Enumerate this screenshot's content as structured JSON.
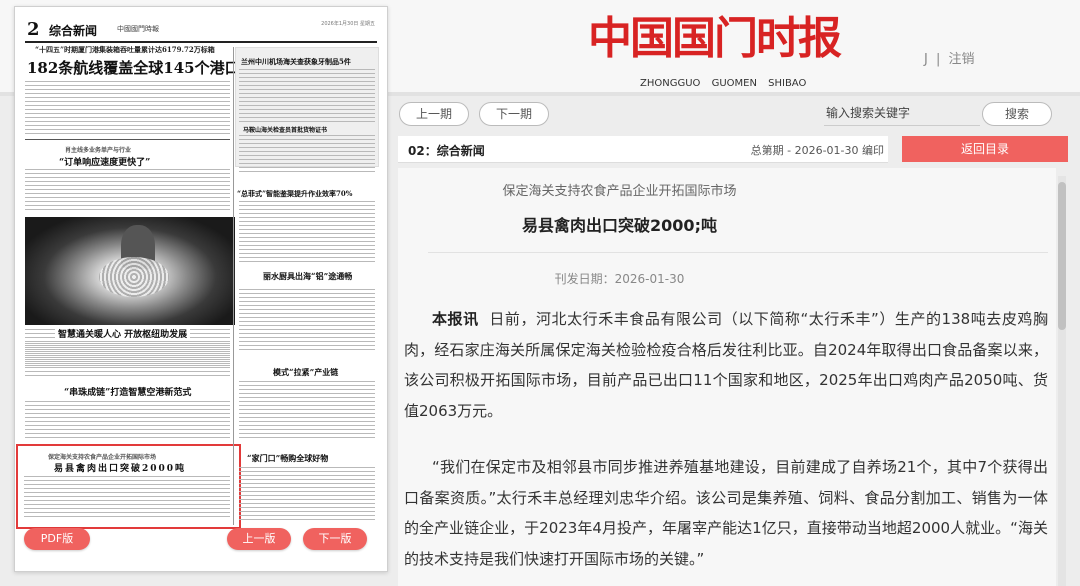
{
  "paper": {
    "page_number": "2",
    "section": "综合新闻",
    "masthead_small": "中國國門時報",
    "date_small": "2026年1月30日 星期五",
    "kicker_top": "“十四五”时期厦门港集装箱吞吐量累计达6179.72万标箱",
    "headline_main": "182条航线覆盖全球145个港口",
    "kicker_2": "肖主线多业务单产与行业",
    "headline_2": "“订单响应速度更快了”",
    "headline_3": "智慧通关暖人心  开放枢纽助发展",
    "headline_4": "“串珠成链”打造智慧空港新范式",
    "kicker_5": "保定海关支持农食产品企业开拓国际市场",
    "headline_5": "易县禽肉出口突破2000吨",
    "side_1": "兰州中川机场海关查获象牙制品5件",
    "side_2": "马鞍山海关检查员首批货物证书",
    "side_3": "“总菲式”智能鉴渠提升作业效率70%",
    "side_4": "丽水厨具出海“铝”途通畅",
    "side_5": "模式“拉紧”产业链",
    "side_6": "“家门口”畅购全球好物",
    "pdf_label": "PDF版",
    "prev_label": "上一版",
    "next_label": "下一版"
  },
  "header": {
    "logo_cn": "中国国门时报",
    "logo_en": "ZHONGGUO GUOMEN SHIBAO",
    "user_initial": "J",
    "separator": "|",
    "logout": "注销"
  },
  "nav": {
    "prev_issue": "上一期",
    "next_issue": "下一期",
    "search_placeholder": "输入搜索关键字",
    "search_button": "搜索",
    "section_label": "02：综合新闻",
    "issue_info": "总第期 - 2026-01-30 编印",
    "back_button": "返回目录"
  },
  "article": {
    "subtitle": "保定海关支持农食产品企业开拓国际市场",
    "title": "易县禽肉出口突破2000;吨",
    "pubdate": "刊发日期：2026-01-30",
    "lead": "本报讯",
    "para1": "日前，河北太行禾丰食品有限公司（以下简称“太行禾丰”）生产的138吨去皮鸡胸肉，经石家庄海关所属保定海关检验检疫合格后发往利比亚。自2024年取得出口食品备案以来，该公司积极开拓国际市场，目前产品已出口11个国家和地区，2025年出口鸡肉产品2050吨、货值2063万元。",
    "para2": "“我们在保定市及相邻县市同步推进养殖基地建设，目前建成了自养场21个，其中7个获得出口备案资质。”太行禾丰总经理刘忠华介绍。该公司是集养殖、饲料、食品分割加工、销售为一体的全产业链企业，于2023年4月投产，年屠宰产能达1亿只，直接带动当地超2000人就业。“海关的技术支持是我们快速打开国际市场的关键。”"
  },
  "colors": {
    "brand_red": "#d82323",
    "button_red": "#f0625f",
    "highlight_border": "#e23a3a"
  }
}
